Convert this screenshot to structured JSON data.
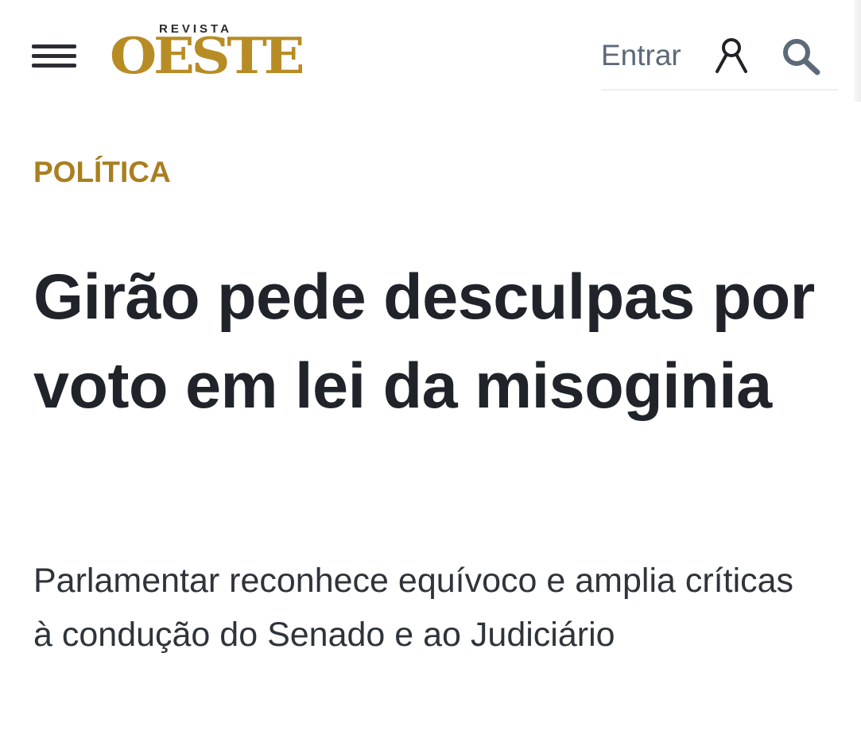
{
  "header": {
    "menu_icon": "hamburger-menu-icon",
    "logo": {
      "small_text": "REVISTA",
      "brand_text": "OESTE",
      "brand_color": "#B88C25"
    },
    "login_label": "Entrar",
    "user_icon": "user-icon",
    "search_icon": "search-icon"
  },
  "article": {
    "category": "POLÍTICA",
    "category_color": "#A97F1F",
    "headline": "Girão pede desculpas por voto em lei da misoginia",
    "subtitle": "Parlamentar reconhece equívoco e amplia críticas à condução do Senado e ao Judiciário"
  }
}
